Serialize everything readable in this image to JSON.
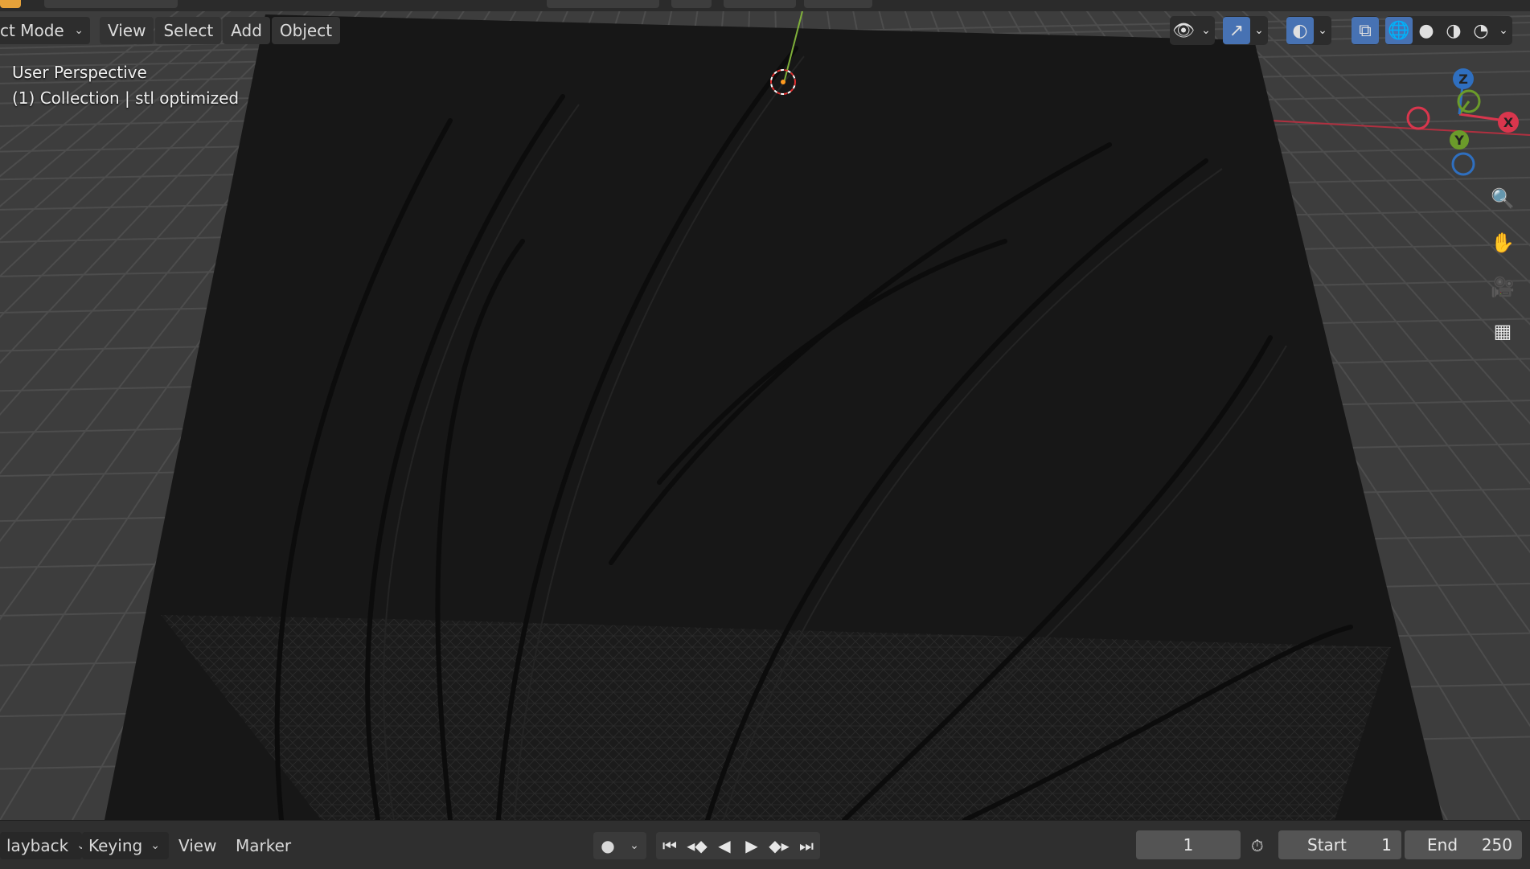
{
  "header": {
    "mode_label": "ct Mode",
    "menus": [
      "View",
      "Select",
      "Add",
      "Object"
    ]
  },
  "overlay": {
    "perspective": "User Perspective",
    "collection": "(1) Collection | stl optimized"
  },
  "gizmo": {
    "x": "X",
    "y": "Y",
    "z": "Z"
  },
  "timeline": {
    "playback_label": "layback",
    "keying_label": "Keying",
    "view_label": "View",
    "marker_label": "Marker",
    "current_frame": "1",
    "start_label": "Start",
    "start_value": "1",
    "end_label": "End",
    "end_value": "250"
  },
  "colors": {
    "accent": "#4772b3",
    "x_axis": "#d9364d",
    "y_axis": "#6b9b2a",
    "z_axis": "#2f6fbf"
  }
}
